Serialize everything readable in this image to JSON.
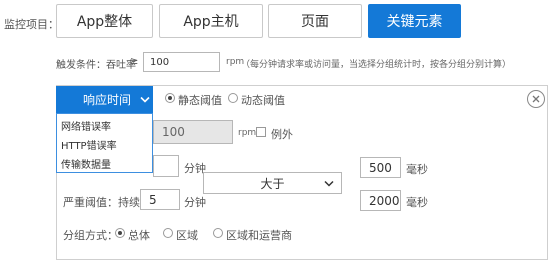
{
  "monitor": {
    "label": "监控项目：",
    "tabs": [
      {
        "label": "App整体",
        "active": false
      },
      {
        "label": "App主机",
        "active": false
      },
      {
        "label": "页面",
        "active": false
      },
      {
        "label": "关键元素",
        "active": true
      }
    ]
  },
  "trigger": {
    "label": "触发条件：吞吐率",
    "operator": "≥",
    "value": "100",
    "unit": "rpm",
    "hint": "（每分钟请求率或访问量，当选择分组统计时，按各分组分别计算）"
  },
  "rule": {
    "metric_selected": "响应时间",
    "metric_options": [
      "网络错误率",
      "HTTP错误率",
      "传输数据量"
    ],
    "threshold_type": {
      "static_label": "静态阈值",
      "dynamic_label": "动态阈值",
      "selected": "static"
    },
    "throughput": {
      "value": "100",
      "unit": "rpm",
      "exception_label": "例外"
    },
    "warning": {
      "duration_unit": "分钟",
      "value": "500",
      "value_unit": "毫秒"
    },
    "comparator": "大于",
    "severe": {
      "label": "严重阈值：持续",
      "duration": "5",
      "duration_unit": "分钟",
      "value": "2000",
      "value_unit": "毫秒"
    },
    "grouping": {
      "label": "分组方式：",
      "options": [
        "总体",
        "区域",
        "区域和运营商"
      ],
      "selected": "总体"
    }
  },
  "colors": {
    "accent": "#1479d7",
    "border": "#cfcfcf"
  },
  "icons": {
    "close": "close-circle-icon",
    "dropdown": "chevron-down-icon"
  }
}
